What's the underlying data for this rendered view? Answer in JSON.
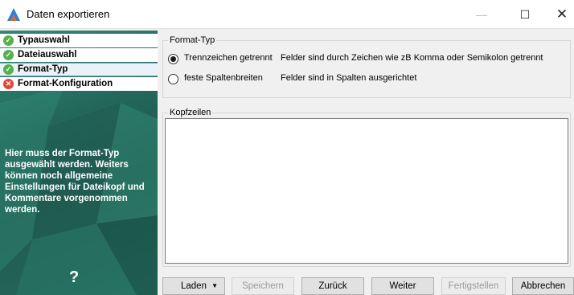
{
  "window": {
    "title": "Daten exportieren",
    "app_icon": "app-a-icon",
    "minimize_icon": "—",
    "maximize_icon": "☐",
    "close_icon": "✕"
  },
  "wizard": {
    "steps": [
      {
        "label": "Typauswahl",
        "status": "done"
      },
      {
        "label": "Dateiauswahl",
        "status": "done"
      },
      {
        "label": "Format-Typ",
        "status": "current"
      },
      {
        "label": "Format-Konfiguration",
        "status": "error"
      }
    ],
    "help_text": "Hier muss der Format-Typ ausgewählt werden. Weiters können noch allgemeine Einstellungen für Dateikopf und Kommentare vorgenommen werden.",
    "help_icon": "?"
  },
  "format_group": {
    "title": "Format-Typ",
    "options": [
      {
        "label": "Trennzeichen getrennt",
        "description": "Felder sind durch Zeichen wie zB Komma oder Semikolon getrennt",
        "selected": true
      },
      {
        "label": "feste Spaltenbreiten",
        "description": "Felder sind in Spalten ausgerichtet",
        "selected": false
      }
    ]
  },
  "header_group": {
    "title": "Kopfzeilen",
    "value": ""
  },
  "buttons": {
    "load": "Laden",
    "save": "Speichern",
    "back": "Zurück",
    "next": "Weiter",
    "finish": "Fertigstellen",
    "cancel": "Abbrechen"
  },
  "colors": {
    "panel": "#2b7161",
    "ok": "#55b14b",
    "error": "#e0483a",
    "active_border": "#6e9cc4"
  }
}
